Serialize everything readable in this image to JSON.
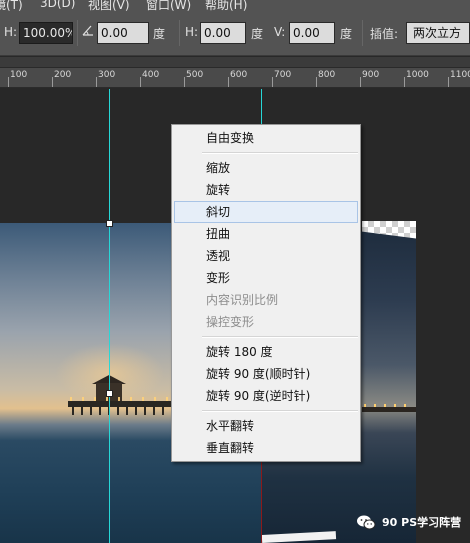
{
  "menubar": {
    "items": [
      "视图(V)",
      "窗口(W)",
      "帮助(H)"
    ],
    "partial": [
      "镜(T)",
      "3D(D)"
    ]
  },
  "options": {
    "h_label": "H:",
    "h_value": "100.00%",
    "angle_value": "0.00",
    "angle_unit": "度",
    "hskew_label": "H:",
    "hskew_value": "0.00",
    "hskew_unit": "度",
    "vskew_label": "V:",
    "vskew_value": "0.00",
    "vskew_unit": "度",
    "interp_label": "插值:",
    "interp_value": "两次立方"
  },
  "ruler": {
    "ticks": [
      "100",
      "200",
      "300",
      "400",
      "500",
      "600",
      "700",
      "800",
      "900",
      "1000",
      "1100"
    ]
  },
  "context_menu": {
    "items": [
      {
        "label": "自由变换",
        "enabled": true
      },
      {
        "label": "缩放",
        "enabled": true
      },
      {
        "label": "旋转",
        "enabled": true
      },
      {
        "label": "斜切",
        "enabled": true,
        "highlighted": true
      },
      {
        "label": "扭曲",
        "enabled": true
      },
      {
        "label": "透视",
        "enabled": true
      },
      {
        "label": "变形",
        "enabled": true
      },
      {
        "label": "内容识别比例",
        "enabled": false
      },
      {
        "label": "操控变形",
        "enabled": false
      },
      {
        "label": "旋转 180 度",
        "enabled": true
      },
      {
        "label": "旋转 90 度(顺时针)",
        "enabled": true
      },
      {
        "label": "旋转 90 度(逆时针)",
        "enabled": true
      },
      {
        "label": "水平翻转",
        "enabled": true
      },
      {
        "label": "垂直翻转",
        "enabled": true
      }
    ]
  },
  "watermark": {
    "text": "90 PS学习阵营",
    "icon": "wechat-icon"
  },
  "colors": {
    "guide": "#27d7d7",
    "highlight": "#e6eef8",
    "panel": "#535353"
  }
}
